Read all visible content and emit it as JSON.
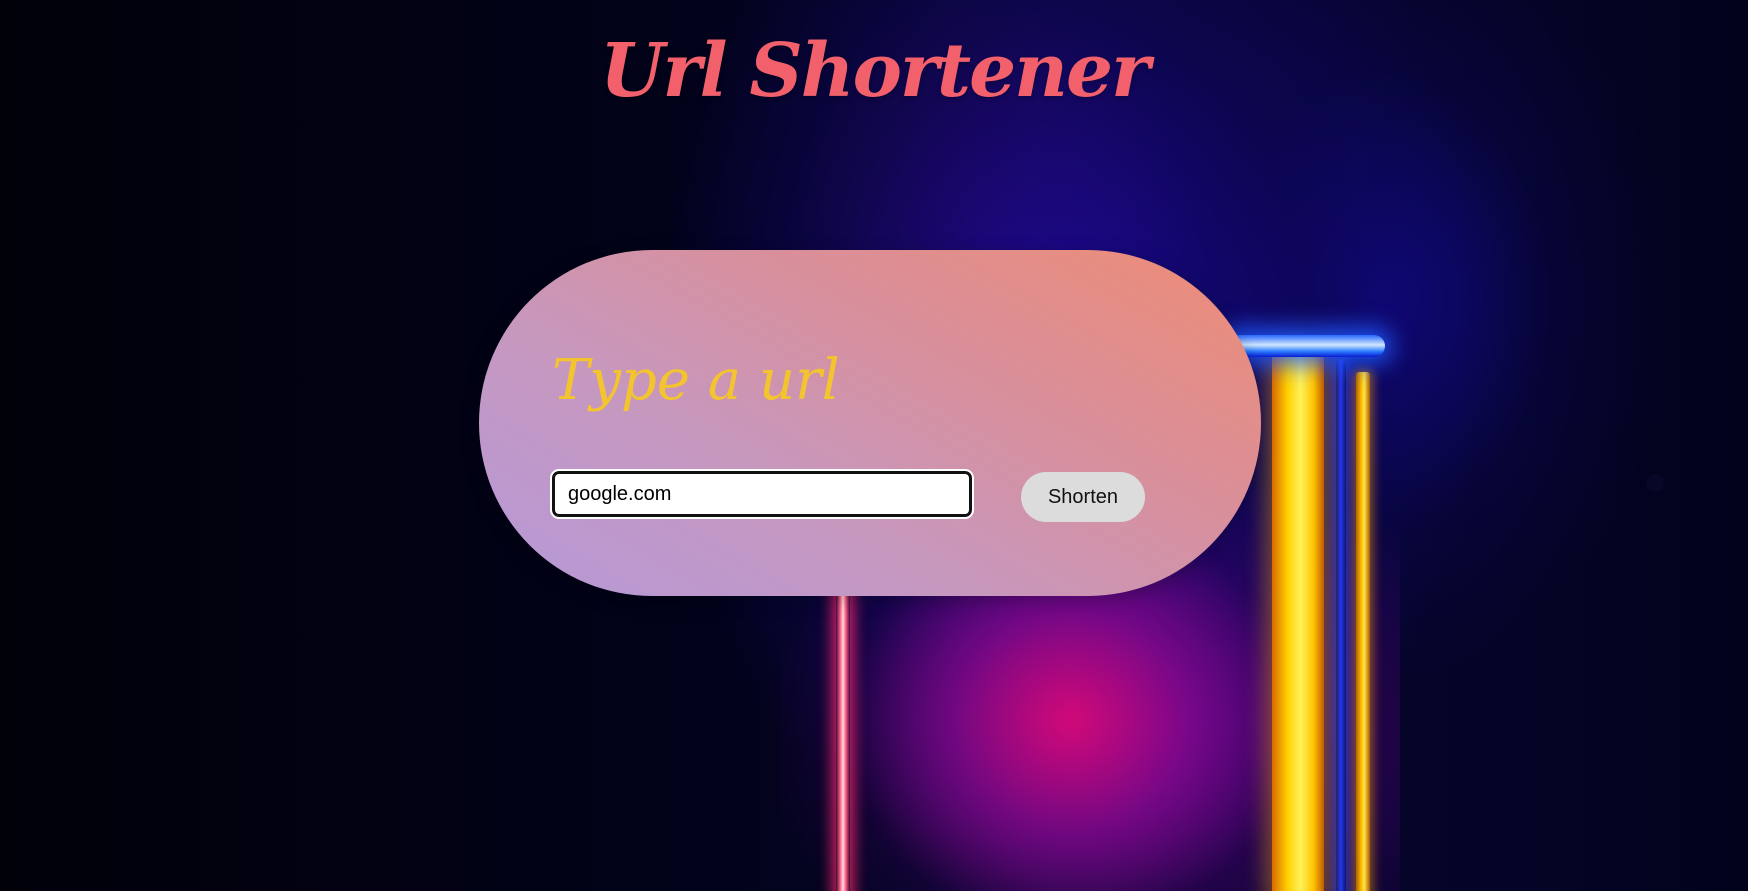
{
  "app": {
    "title": "Url Shortener"
  },
  "form": {
    "heading": "Type a url",
    "url_value": "google.com",
    "submit_label": "Shorten"
  },
  "colors": {
    "title": "#f2606c",
    "heading": "#f4c42e",
    "card_gradient_start": "#b599d9",
    "card_gradient_end": "#ef8c74",
    "button_bg": "#dcdcdc"
  }
}
